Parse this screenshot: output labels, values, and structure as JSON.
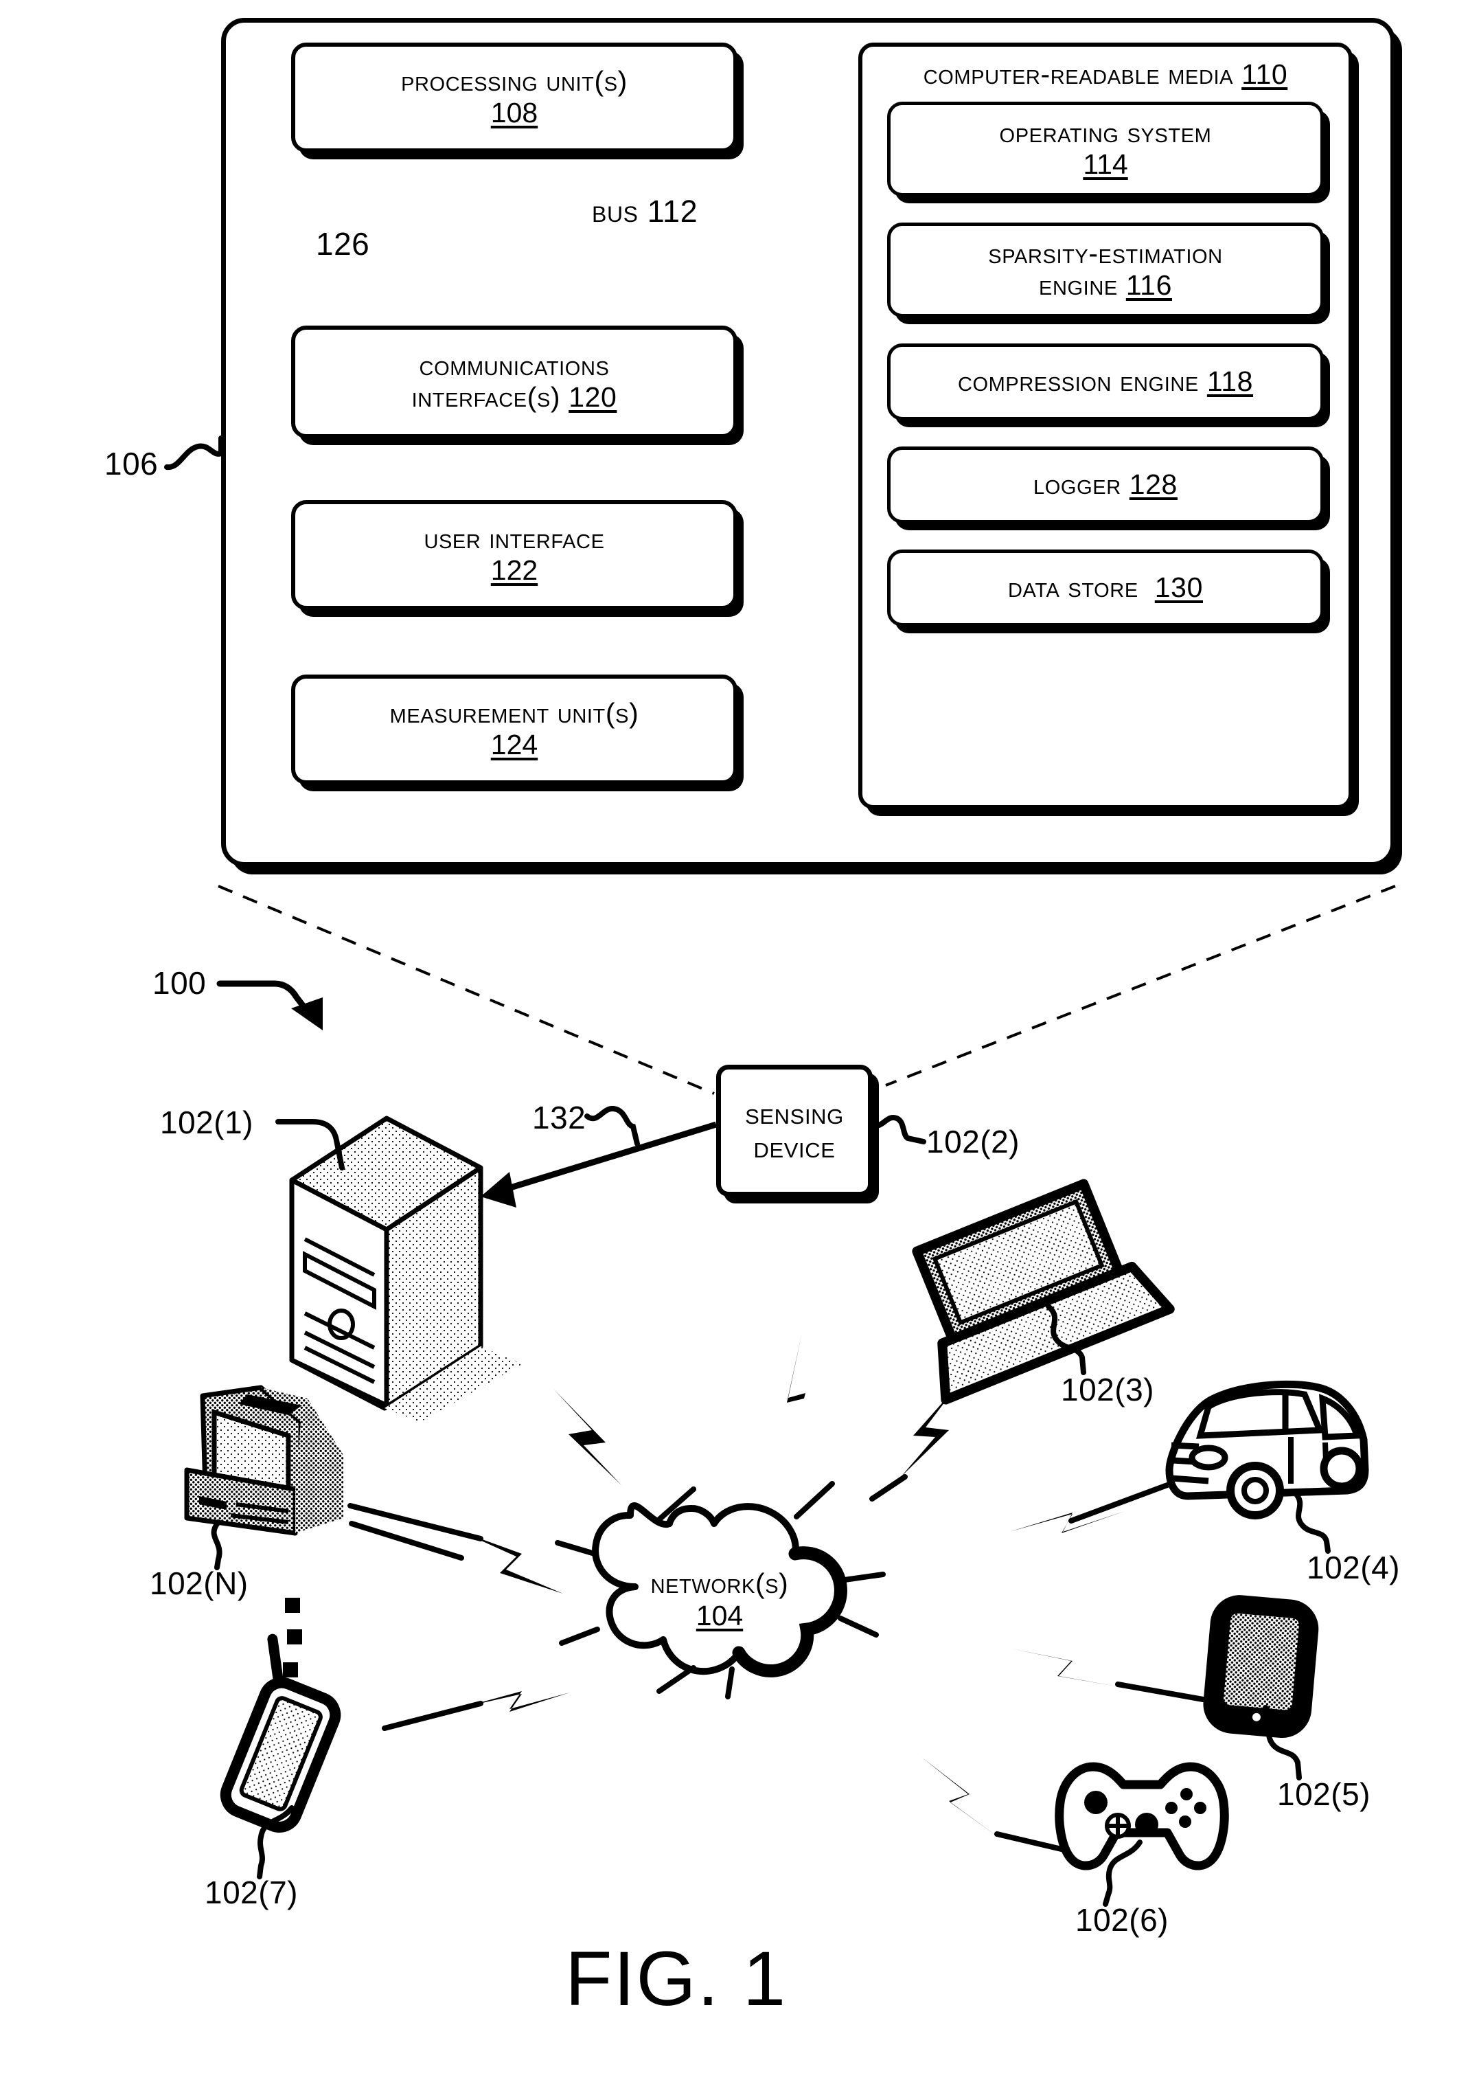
{
  "figure": {
    "caption": "FIG. 1",
    "system_ref": "100",
    "device_ref": "106",
    "interface_callout_ref": "126",
    "data_flow_ref": "132"
  },
  "device_block": {
    "bus_label": "Bus 112",
    "left_column": [
      {
        "name": "processing-unit",
        "title": "Processing Unit(s)",
        "number": "108"
      },
      {
        "name": "communications-interface",
        "title": "Communications",
        "title2": "Interface(s)",
        "number": "120",
        "inline_number": true
      },
      {
        "name": "user-interface",
        "title": "User Interface",
        "number": "122"
      },
      {
        "name": "measurement-unit",
        "title": "Measurement Unit(s)",
        "number": "124"
      }
    ],
    "media": {
      "title": "Computer-Readable Media",
      "number": "110",
      "items": [
        {
          "name": "operating-system",
          "title": "Operating System",
          "number": "114",
          "inline_number": false
        },
        {
          "name": "sparsity-estimation-engine",
          "title": "Sparsity-Estimation",
          "title2": "Engine",
          "number": "116",
          "inline_number": true
        },
        {
          "name": "compression-engine",
          "title": "Compression Engine",
          "number": "118",
          "inline_number": true
        },
        {
          "name": "logger",
          "title": "Logger",
          "number": "128",
          "inline_number": true
        },
        {
          "name": "data-store",
          "title": "Data Store ",
          "number": "130",
          "inline_number": true
        }
      ]
    }
  },
  "network_diagram": {
    "sensing_device": {
      "line1": "Sensing",
      "line2": "Device"
    },
    "cloud": {
      "title": "Network(s)",
      "number": "104"
    },
    "devices": [
      {
        "name": "desktop-tower",
        "label": "102(1)",
        "icon": "desktop-tower-icon"
      },
      {
        "name": "sensing-device",
        "label": "102(2)",
        "icon": "sensing-device-icon"
      },
      {
        "name": "laptop",
        "label": "102(3)",
        "icon": "laptop-icon"
      },
      {
        "name": "automobile",
        "label": "102(4)",
        "icon": "car-icon"
      },
      {
        "name": "tablet",
        "label": "102(5)",
        "icon": "tablet-icon"
      },
      {
        "name": "game-controller",
        "label": "102(6)",
        "icon": "game-controller-icon"
      },
      {
        "name": "mobile-phone",
        "label": "102(7)",
        "icon": "phone-icon"
      },
      {
        "name": "workstation",
        "label": "102(N)",
        "icon": "crt-computer-icon"
      }
    ]
  },
  "colors": {
    "ink": "#000000",
    "paper": "#ffffff"
  }
}
